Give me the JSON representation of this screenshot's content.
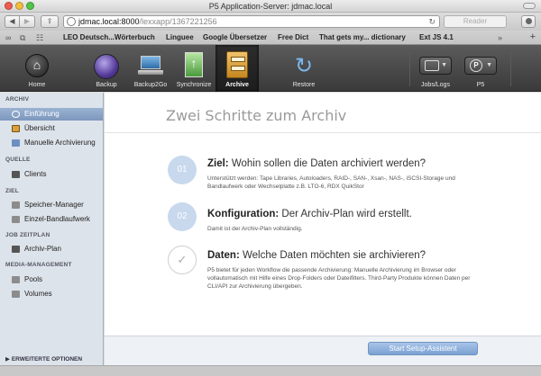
{
  "browser": {
    "window_title": "P5 Application-Server: jdmac.local",
    "url_host": "jdmac.local:8000",
    "url_path": "/lexxapp/1367221256",
    "reader_label": "Reader",
    "bookmarks": [
      "LEO Deutsch...Wörterbuch",
      "Linguee",
      "Google Übersetzer",
      "Free Dict",
      "That gets my... dictionary",
      "Ext JS 4.1"
    ]
  },
  "toolbar": {
    "home": "Home",
    "backup": "Backup",
    "backup2go": "Backup2Go",
    "synchronize": "Synchronize",
    "archive": "Archive",
    "restore": "Restore",
    "jobs_logs": "Jobs/Logs",
    "p5": "P5",
    "p5_glyph": "P"
  },
  "sidebar": {
    "sections": {
      "archiv": "ARCHIV",
      "quelle": "QUELLE",
      "ziel": "ZIEL",
      "job_zeitplan": "JOB ZEITPLAN",
      "media": "MEDIA-MANAGEMENT"
    },
    "items": {
      "einfuehrung": "Einführung",
      "uebersicht": "Übersicht",
      "manuelle": "Manuelle Archivierung",
      "clients": "Clients",
      "speicher": "Speicher-Manager",
      "einzel": "Einzel-Bandlaufwerk",
      "archivplan": "Archiv-Plan",
      "pools": "Pools",
      "volumes": "Volumes"
    },
    "advanced": "ERWEITERTE OPTIONEN"
  },
  "main": {
    "heading": "Zwei Schritte zum Archiv",
    "steps": [
      {
        "num": "01",
        "title_bold": "Ziel:",
        "title_rest": "Wohin sollen die Daten archiviert werden?",
        "desc": "Unterstützt werden: Tape Libraries, Autoloaders, RAID-, SAN-, Xsan-, NAS-, iSCSI-Storage und Bandlaufwerk oder Wechselplatte z.B. LTO-6, RDX QuikStor"
      },
      {
        "num": "02",
        "title_bold": "Konfiguration:",
        "title_rest": "Der Archiv-Plan wird erstellt.",
        "desc": "Damit ist der Archiv-Plan vollständig."
      },
      {
        "num": "✓",
        "title_bold": "Daten:",
        "title_rest": "Welche Daten möchten sie archivieren?",
        "desc": "P5 bietet für jeden Workflow die passende Archivierung: Manuelle Archivierung im Browser oder vollautomatisch mit Hilfe eines Drop-Folders oder Dateifilters. Third-Party Produkte können Daten per CLI/API zur Archivierung übergeben."
      }
    ],
    "setup_button": "Start Setup-Assistent"
  }
}
